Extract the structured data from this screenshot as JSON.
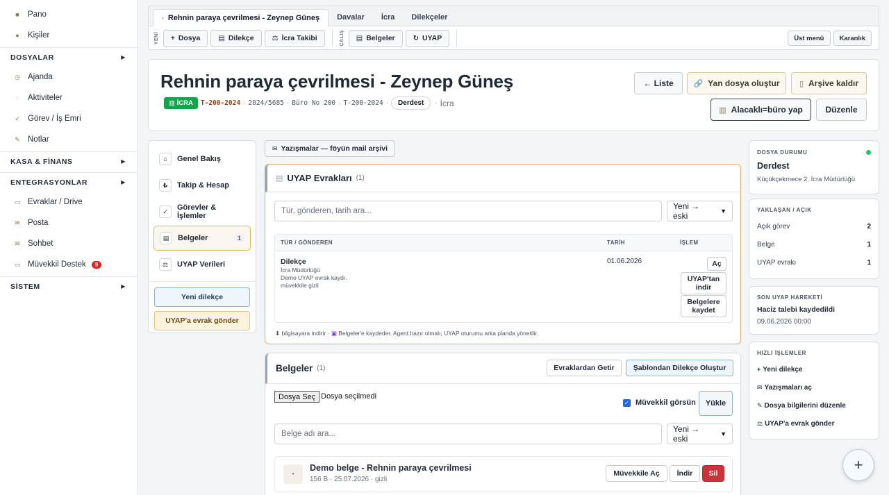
{
  "sidebar": {
    "top_items": [
      {
        "label": "Pano",
        "icon": "grid-icon"
      },
      {
        "label": "Kişiler",
        "icon": "person-icon"
      }
    ],
    "sections": [
      {
        "label": "DOSYALAR",
        "items": [
          {
            "label": "Ajanda",
            "icon": "clock-icon"
          },
          {
            "label": "Aktiviteler",
            "icon": "activity-icon"
          },
          {
            "label": "Görev / İş Emri",
            "icon": "check-icon"
          },
          {
            "label": "Notlar",
            "icon": "pencil-icon"
          }
        ]
      },
      {
        "label": "KASA & FİNANS",
        "items": []
      },
      {
        "label": "ENTEGRASYONLAR",
        "items": [
          {
            "label": "Evraklar / Drive",
            "icon": "folder-icon"
          },
          {
            "label": "Posta",
            "icon": "mail-icon"
          },
          {
            "label": "Sohbet",
            "icon": "chat-icon"
          },
          {
            "label": "Müvekkil Destek",
            "icon": "support-icon",
            "badge": "9"
          }
        ]
      },
      {
        "label": "SİSTEM",
        "items": []
      }
    ]
  },
  "tabs": [
    {
      "label": "Rehnin paraya çevrilmesi - Zeynep Güneş",
      "active": true
    },
    {
      "label": "Davalar"
    },
    {
      "label": "İcra"
    },
    {
      "label": "Dilekçeler"
    }
  ],
  "toolbar": {
    "group1_label": "YENİ",
    "group1": [
      {
        "label": "Dosya",
        "icon": "+"
      },
      {
        "label": "Dilekçe",
        "icon": "▤"
      },
      {
        "label": "İcra Takibi",
        "icon": "⚖"
      }
    ],
    "group2_label": "ÇALIŞ",
    "group2": [
      {
        "label": "Belgeler",
        "icon": "▤"
      },
      {
        "label": "UYAP",
        "icon": "↻"
      }
    ],
    "right": [
      {
        "label": "Üst menü"
      },
      {
        "label": "Karanlık"
      }
    ]
  },
  "header": {
    "title": "Rehnin paraya çevrilmesi - Zeynep Güneş",
    "badge": "İCRA",
    "file_no": "T-200-2024",
    "esas_no": "2024/5685",
    "buro_no": "Büro No 200",
    "file_no2": "T-200-2024",
    "status": "Derdest",
    "type": "İcra",
    "buttons": {
      "liste": "← Liste",
      "yan_dosya": "Yan dosya oluştur",
      "arsive": "Arşive kaldır",
      "alacakli": "Alacaklı=büro yap",
      "duzenle": "Düzenle"
    }
  },
  "leftnav": {
    "items": [
      {
        "label": "Genel Bakış",
        "icon": "⌂"
      },
      {
        "label": "Takip & Hesap",
        "icon": "₺"
      },
      {
        "label": "Görevler & İşlemler",
        "icon": "✓"
      },
      {
        "label": "Belgeler",
        "icon": "▤",
        "count": "1",
        "active": true
      },
      {
        "label": "UYAP Verileri",
        "icon": "⚖"
      }
    ],
    "btn_new": "Yeni dilekçe",
    "btn_send": "UYAP'a evrak gönder"
  },
  "yazismalar_btn": "Yazışmalar — föyün mail arşivi",
  "uyap": {
    "title": "UYAP Evrakları",
    "count": "(1)",
    "search_placeholder": "Tür, gönderen, tarih ara...",
    "sort": "Yeni → eski",
    "columns": [
      "TÜR / GÖNDEREN",
      "TARİH",
      "İŞLEM"
    ],
    "row": {
      "type": "Dilekçe",
      "sender": "İcra Müdürlüğü",
      "desc": "Demo UYAP evrak kaydı.",
      "visibility": "müvekkile gizli",
      "date": "01.06.2026",
      "actions": [
        "Aç",
        "UYAP'tan indir",
        "Belgelere kaydet"
      ]
    },
    "footnote_a": "bilgisayara indirir ·",
    "footnote_b": "Belgeler'e kaydeder. Agent hazır olmalı; UYAP oturumu arka planda yönetilir."
  },
  "belgeler": {
    "title": "Belgeler",
    "count": "(1)",
    "btn_fetch": "Evraklardan Getir",
    "btn_template": "Şablondan Dilekçe Oluştur",
    "file_btn": "Dosya Seç",
    "file_none": "Dosya seçilmedi",
    "client_visible": "Müvekkil görsün",
    "upload": "Yükle",
    "search_placeholder": "Belge adı ara...",
    "sort": "Yeni → eski",
    "doc": {
      "name": "Demo belge - Rehnin paraya çevrilmesi",
      "meta": "156 B · 25.07.2026 · gizli",
      "actions": [
        "Müvekkile Aç",
        "İndir",
        "Sil"
      ]
    }
  },
  "right": {
    "status_label": "DOSYA DURUMU",
    "status": "Derdest",
    "court": "Küçükçekmece 2. İcra Müdürlüğü",
    "upcoming_label": "YAKLAŞAN / AÇIK",
    "rows": [
      {
        "label": "Açık görev",
        "value": "2"
      },
      {
        "label": "Belge",
        "value": "1"
      },
      {
        "label": "UYAP evrakı",
        "value": "1"
      }
    ],
    "last_label": "SON UYAP HAREKETİ",
    "last_title": "Haciz talebi kaydedildi",
    "last_date": "09.06.2026 00:00",
    "quick_label": "HIZLI İŞLEMLER",
    "quick": [
      {
        "label": "Yeni dilekçe",
        "icon": "+"
      },
      {
        "label": "Yazışmaları aç",
        "icon": "✉"
      },
      {
        "label": "Dosya bilgilerini düzenle",
        "icon": "✎"
      },
      {
        "label": "UYAP'a evrak gönder",
        "icon": "⚖"
      }
    ]
  },
  "fab": "+",
  "colors": {
    "accent_green": "#16a34a",
    "accent_tan": "#e3b65d",
    "danger": "#c8343a"
  }
}
